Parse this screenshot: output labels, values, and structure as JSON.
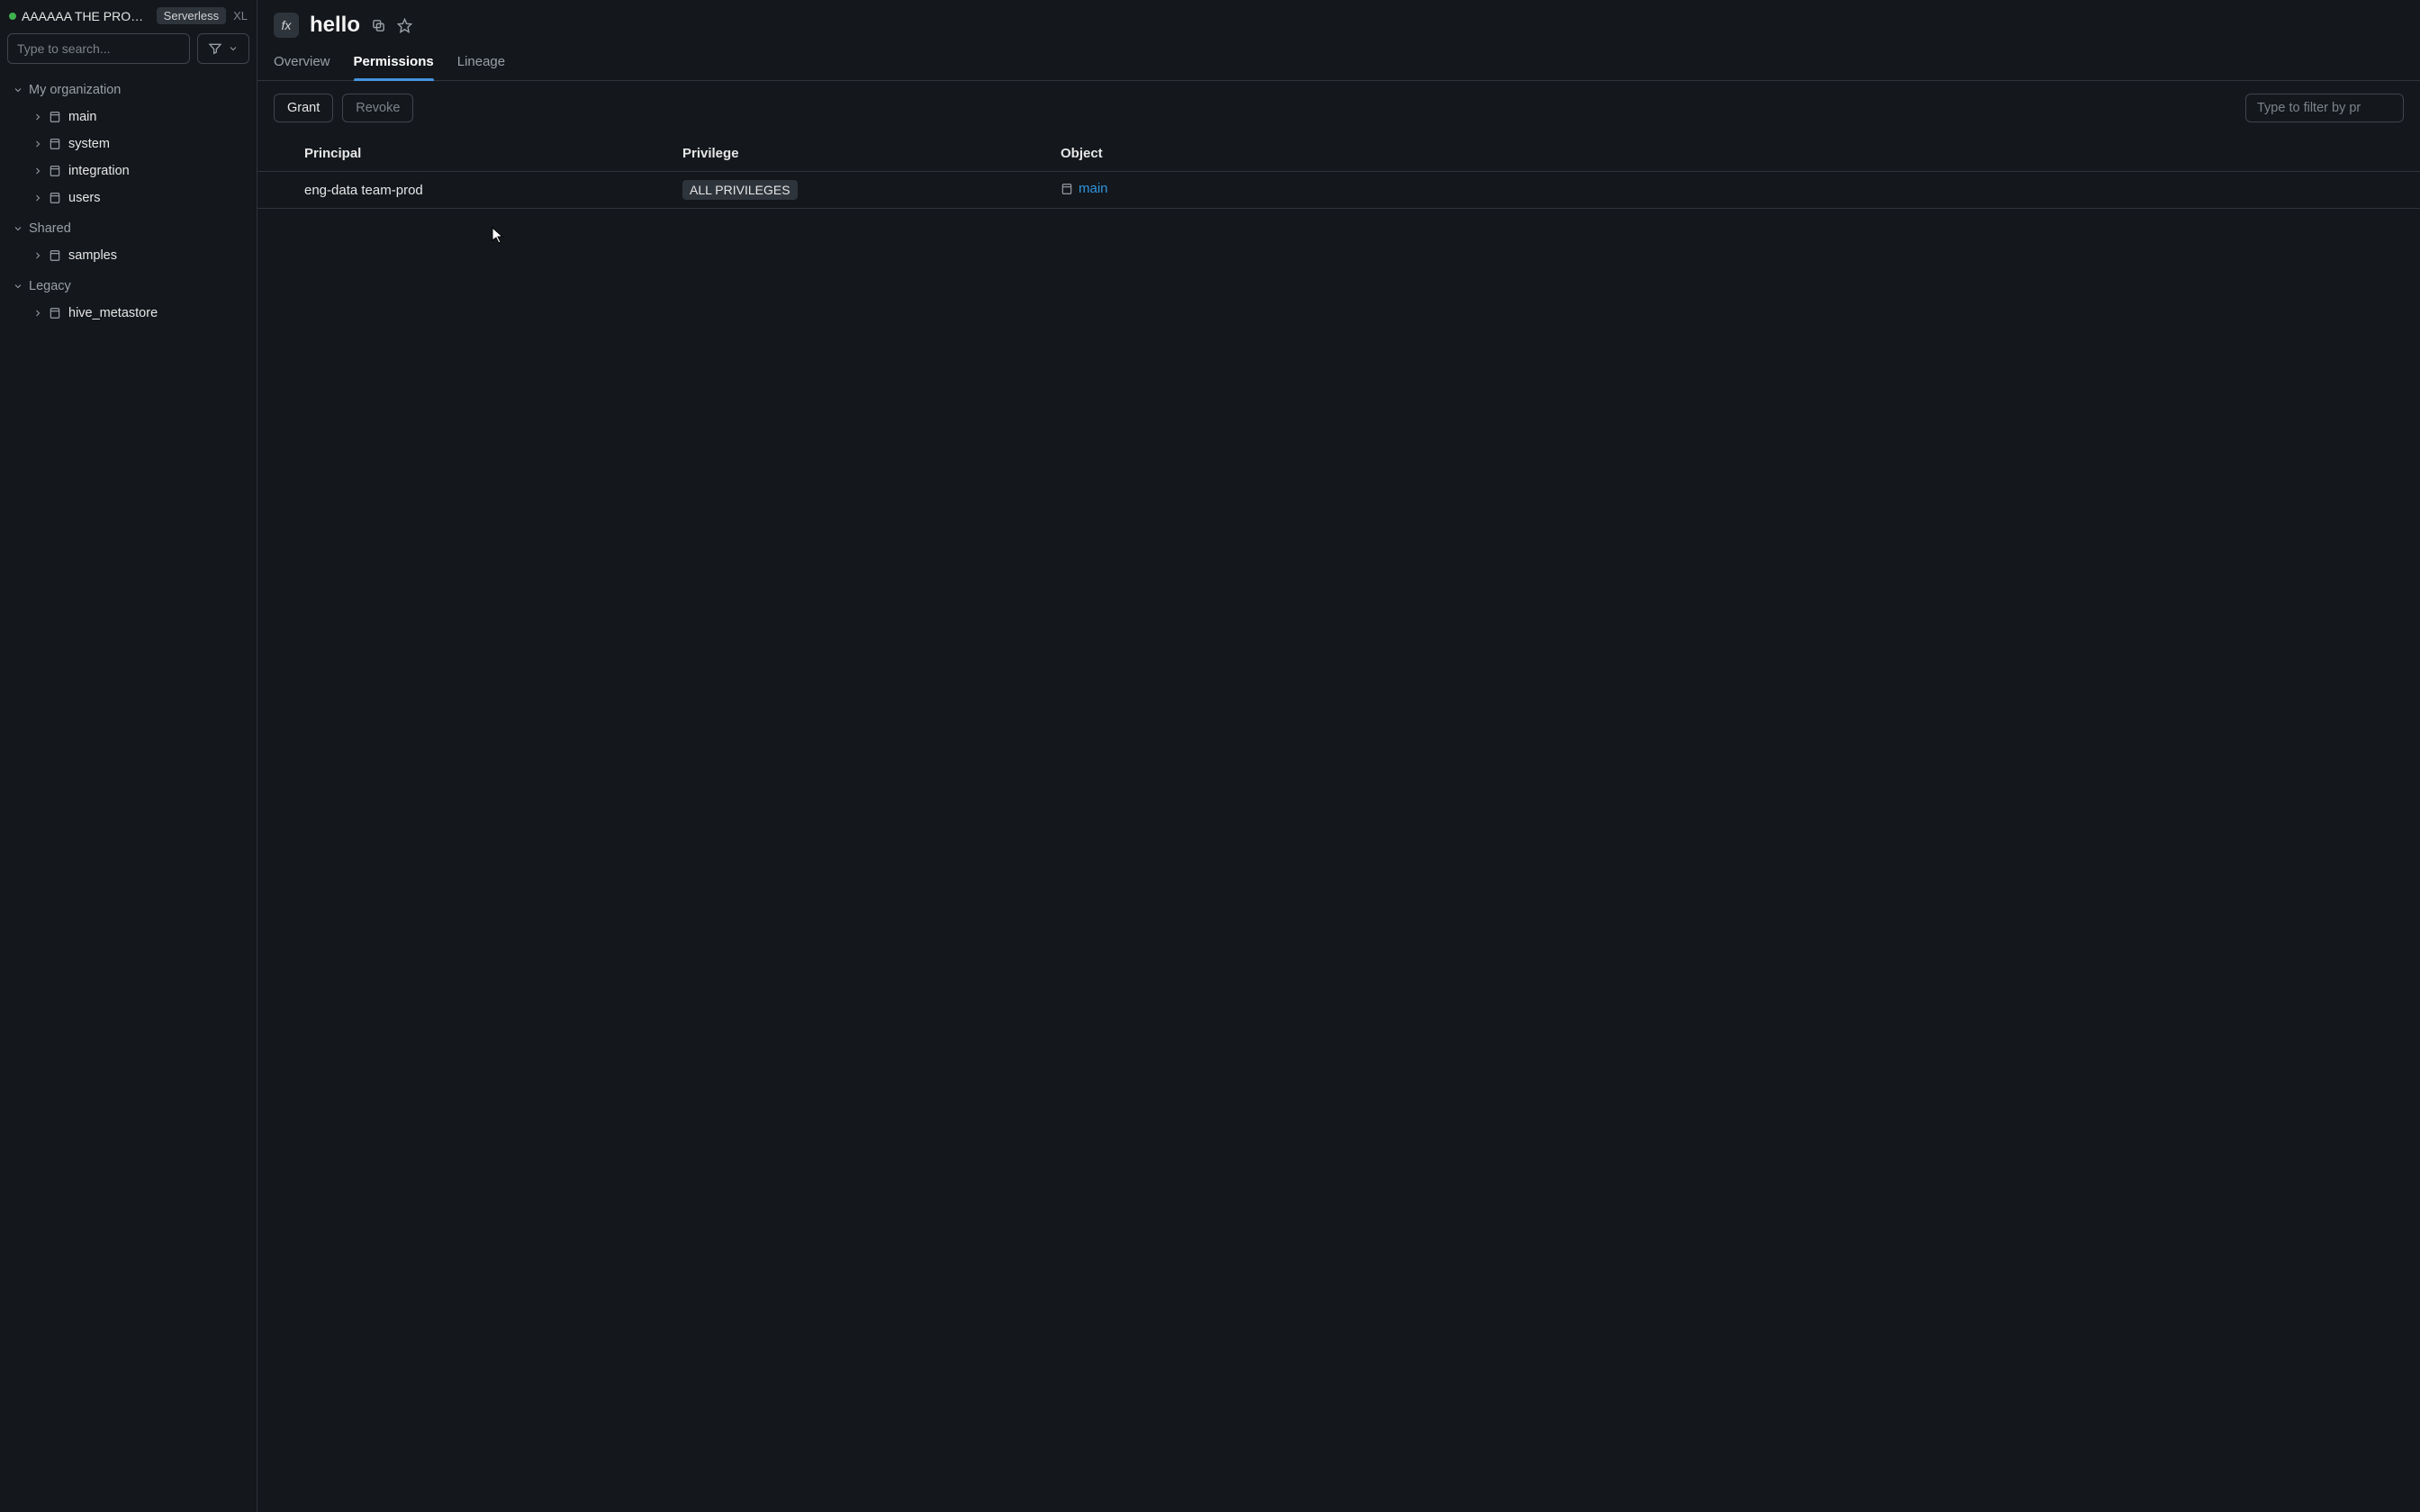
{
  "workspace": {
    "name": "AAAAAA THE PRODU…",
    "tag": "Serverless",
    "size": "XL"
  },
  "search": {
    "placeholder": "Type to search..."
  },
  "tree": {
    "sections": [
      {
        "label": "My organization",
        "items": [
          {
            "label": "main"
          },
          {
            "label": "system"
          },
          {
            "label": "integration"
          },
          {
            "label": "users"
          }
        ]
      },
      {
        "label": "Shared",
        "items": [
          {
            "label": "samples"
          }
        ]
      },
      {
        "label": "Legacy",
        "items": [
          {
            "label": "hive_metastore"
          }
        ]
      }
    ]
  },
  "header": {
    "fx": "fx",
    "title": "hello"
  },
  "tabs": [
    {
      "label": "Overview",
      "active": false
    },
    {
      "label": "Permissions",
      "active": true
    },
    {
      "label": "Lineage",
      "active": false
    }
  ],
  "toolbar": {
    "grant": "Grant",
    "revoke": "Revoke",
    "filter_placeholder": "Type to filter by pr"
  },
  "table": {
    "columns": {
      "principal": "Principal",
      "privilege": "Privilege",
      "object": "Object"
    },
    "rows": [
      {
        "principal": "eng-data team-prod",
        "privilege": "ALL PRIVILEGES",
        "object": "main"
      }
    ]
  }
}
